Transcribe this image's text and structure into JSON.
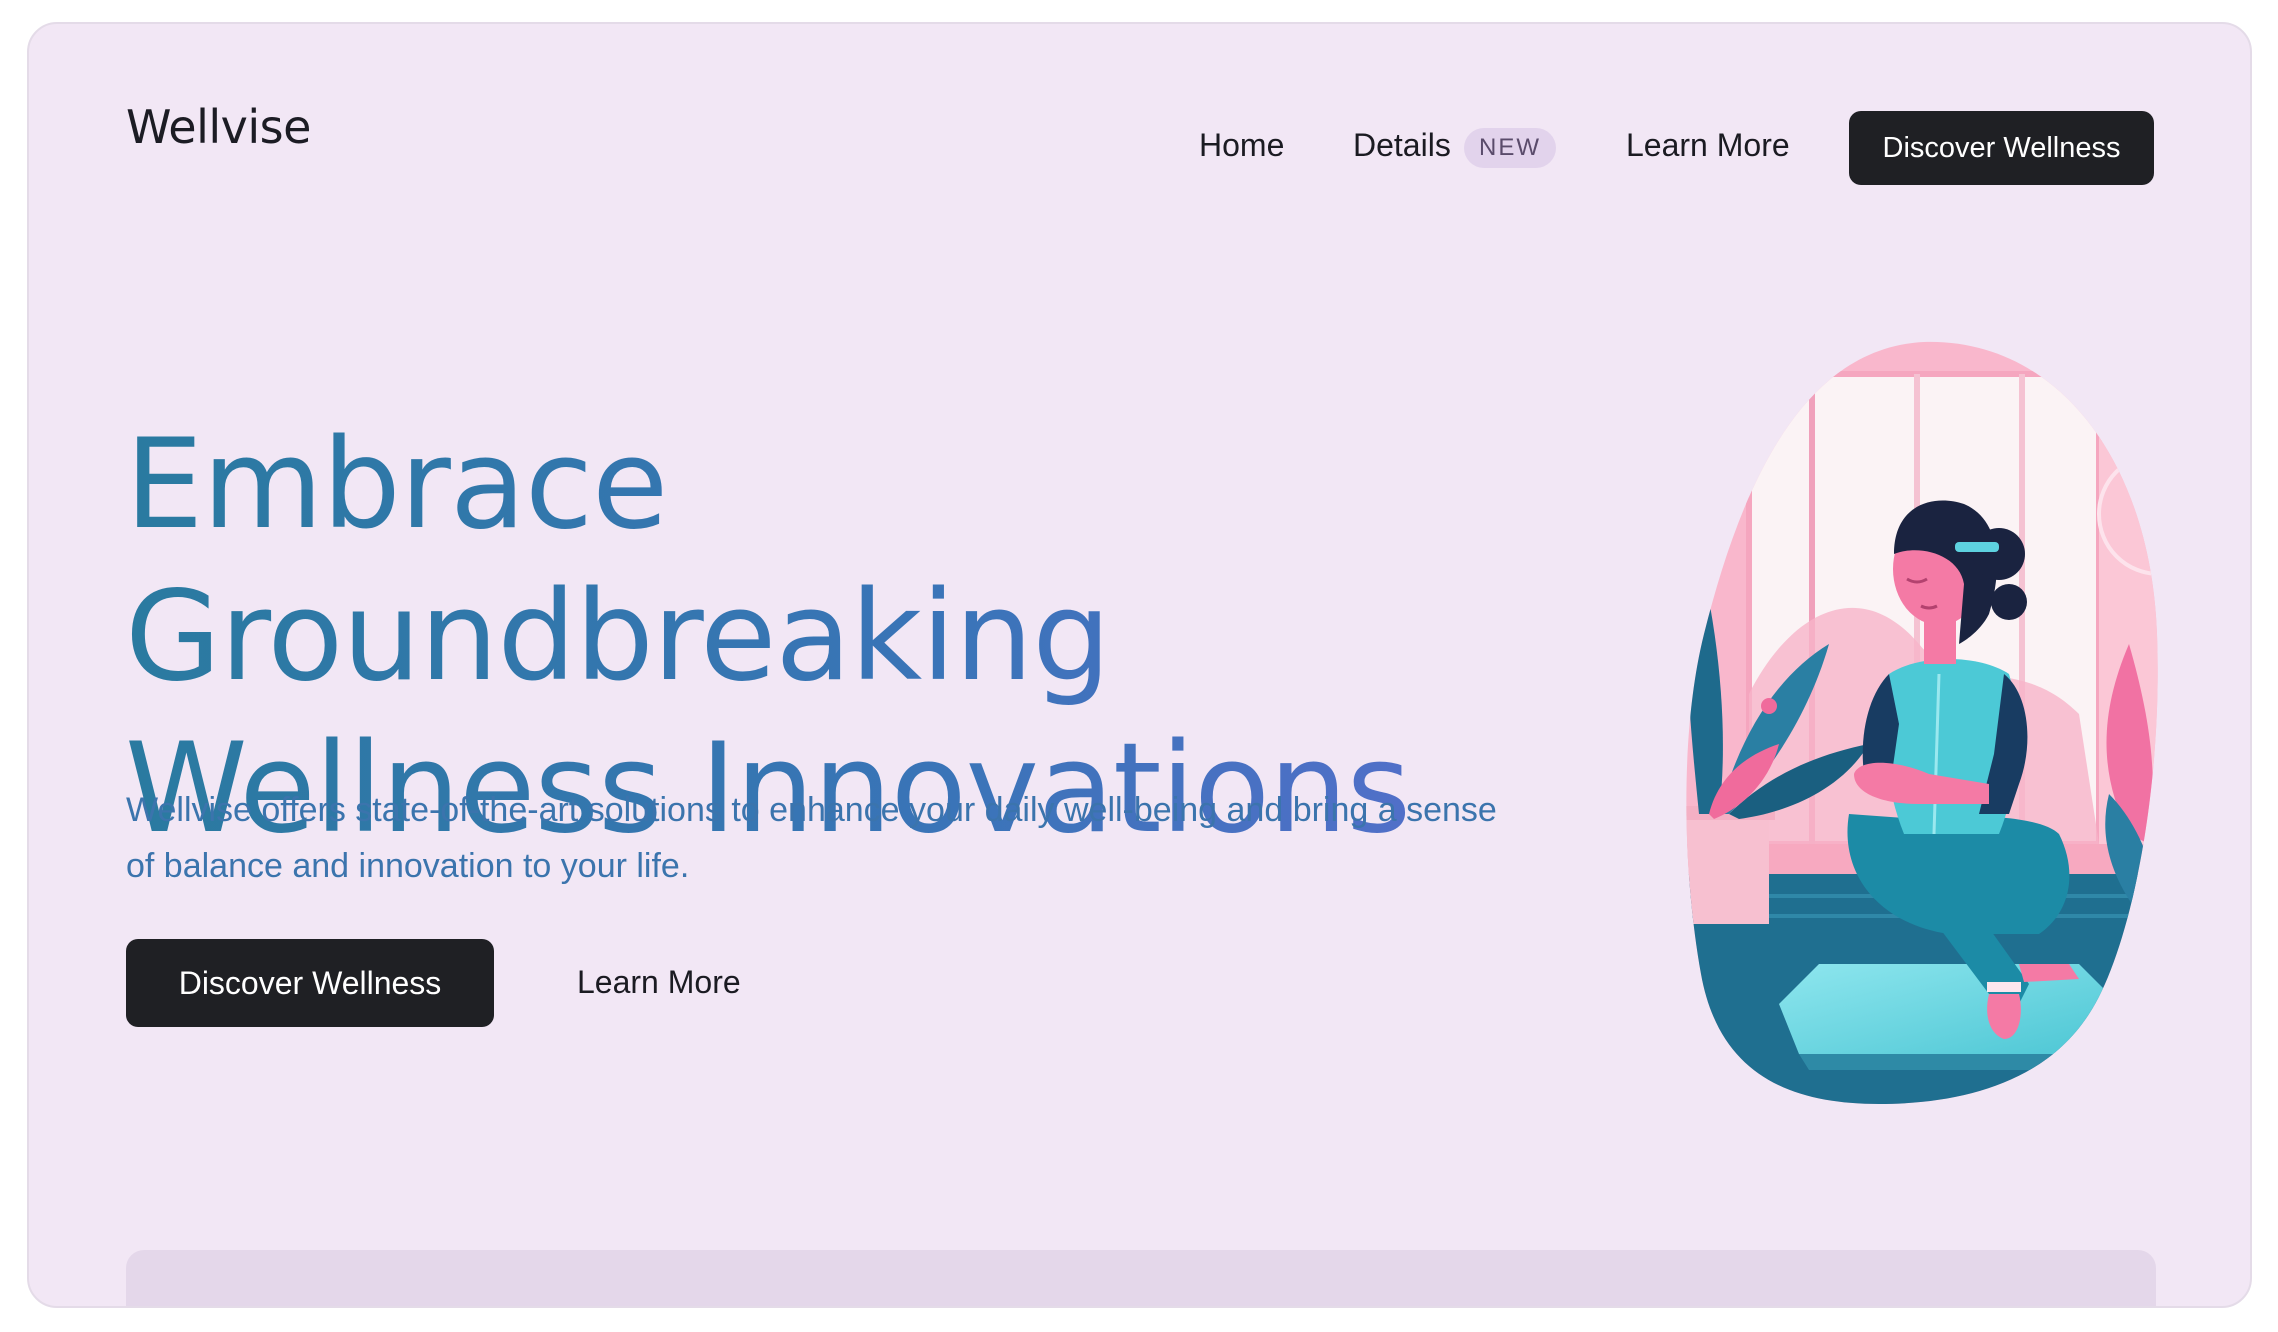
{
  "brand": {
    "name": "Wellvise"
  },
  "nav": {
    "items": [
      {
        "label": "Home"
      },
      {
        "label": "Details",
        "badge": "NEW"
      },
      {
        "label": "Learn More"
      }
    ],
    "cta_label": "Discover Wellness"
  },
  "hero": {
    "headline_line1": "Embrace Groundbreaking",
    "headline_line2": "Wellness Innovations",
    "subtitle": "Wellvise offers state-of-the-art solutions to enhance your daily well-being and bring a sense of balance and innovation to your life.",
    "primary_cta": "Discover Wellness",
    "secondary_cta": "Learn More"
  },
  "colors": {
    "background": "#f2e7f5",
    "dark_button": "#1f2024",
    "headline_gradient_start": "#2a7aa0",
    "headline_gradient_end": "#5b6dd0",
    "subtitle": "#3b74ad",
    "badge_bg": "#e2d3ec"
  },
  "illustration": {
    "icon": "meditating-woman-illustration"
  }
}
